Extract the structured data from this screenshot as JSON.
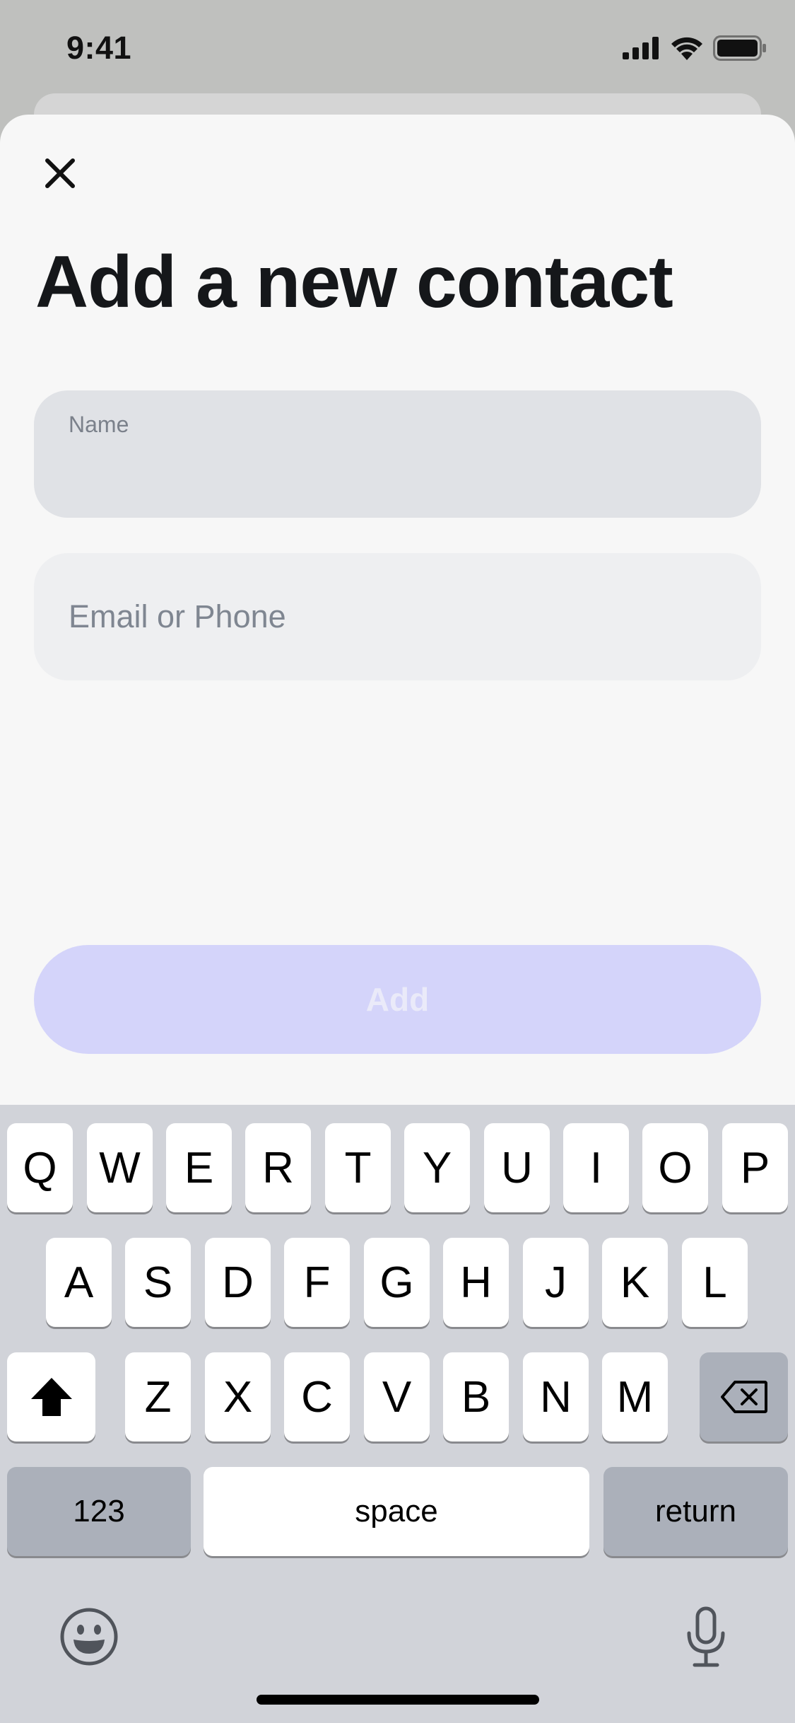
{
  "status_bar": {
    "time": "9:41",
    "icons": [
      "cellular-signal-icon",
      "wifi-icon",
      "battery-icon"
    ]
  },
  "sheet": {
    "close_icon": "close-icon",
    "title": "Add a new contact",
    "fields": {
      "name": {
        "label": "Name",
        "value": ""
      },
      "contact": {
        "placeholder": "Email or Phone",
        "value": ""
      }
    },
    "add_button": "Add"
  },
  "keyboard": {
    "row1": [
      "Q",
      "W",
      "E",
      "R",
      "T",
      "Y",
      "U",
      "I",
      "O",
      "P"
    ],
    "row2": [
      "A",
      "S",
      "D",
      "F",
      "G",
      "H",
      "J",
      "K",
      "L"
    ],
    "row3": [
      "Z",
      "X",
      "C",
      "V",
      "B",
      "N",
      "M"
    ],
    "numbers_key": "123",
    "space_key": "space",
    "return_key": "return",
    "icons": [
      "shift-icon",
      "backspace-icon",
      "emoji-icon",
      "microphone-icon"
    ]
  },
  "colors": {
    "accent_disabled": "#d4d4fa",
    "sheet_bg": "#f7f7f7",
    "keyboard_bg": "#d1d3d9"
  }
}
